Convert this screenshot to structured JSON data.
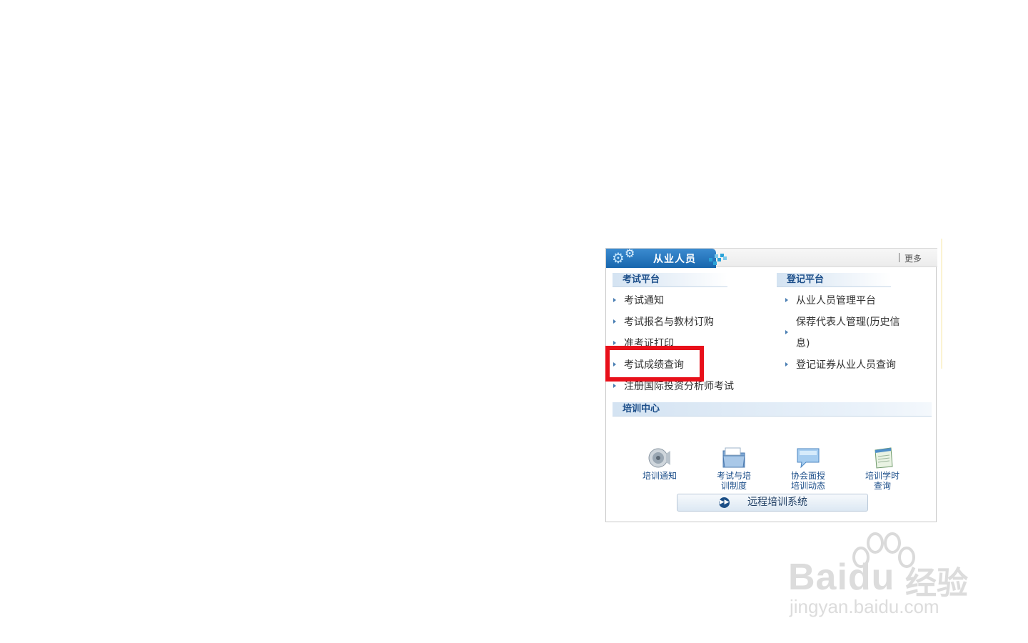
{
  "panel": {
    "title": "从业人员",
    "more": "更多"
  },
  "exam": {
    "header": "考试平台",
    "items": [
      {
        "label": "考试通知"
      },
      {
        "label": "考试报名与教材订购"
      },
      {
        "label": "准考证打印"
      },
      {
        "label": "考试成绩查询"
      },
      {
        "label": "注册国际投资分析师考试"
      }
    ]
  },
  "registration": {
    "header": "登记平台",
    "items": [
      {
        "label": "从业人员管理平台"
      },
      {
        "label": "保荐代表人管理(历史信息)"
      },
      {
        "label": "登记证券从业人员查询"
      }
    ]
  },
  "training": {
    "header": "培训中心",
    "items": [
      {
        "line1": "培训通知",
        "line2": "",
        "icon": "speaker-icon"
      },
      {
        "line1": "考试与培",
        "line2": "训制度",
        "icon": "folder-icon"
      },
      {
        "line1": "协会面授",
        "line2": "培训动态",
        "icon": "chat-bubble-icon"
      },
      {
        "line1": "培训学时",
        "line2": "查询",
        "icon": "notepad-icon"
      }
    ],
    "remote_button": "远程培训系统"
  },
  "watermark": {
    "brand": "Bai",
    "brand_tail": "du",
    "brand_cn": "经验",
    "url": "jingyan.baidu.com"
  },
  "colors": {
    "accent": "#1766ad",
    "highlight": "#e8101a",
    "link": "#1d4f8a"
  }
}
